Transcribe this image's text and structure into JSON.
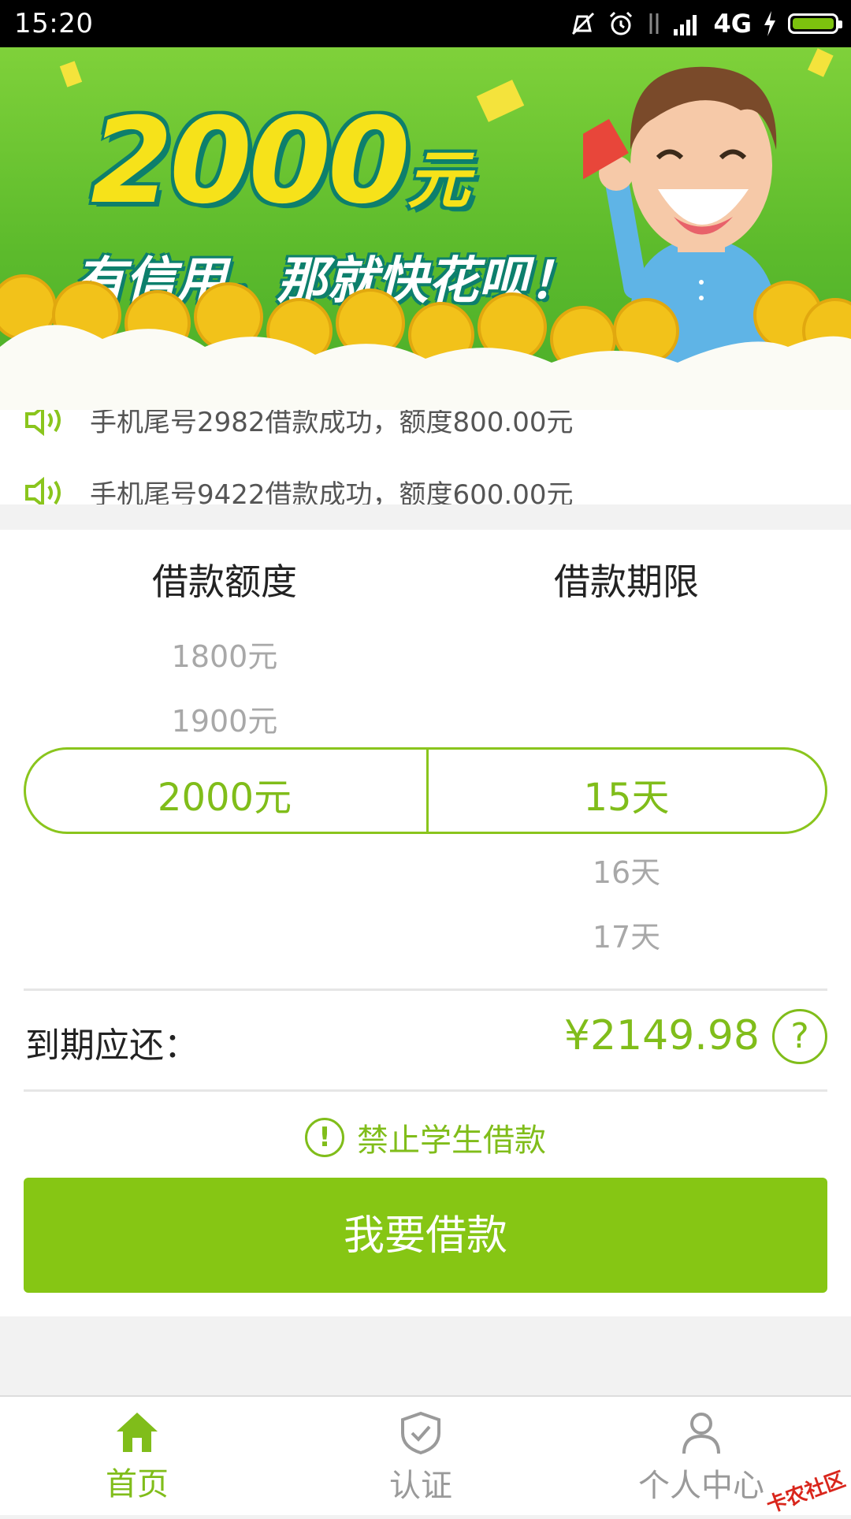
{
  "status_bar": {
    "time": "15:20",
    "network": "4G",
    "icons": [
      "mute-icon",
      "alarm-icon",
      "data-arrows-icon",
      "signal-icon",
      "charging-icon",
      "battery-icon"
    ]
  },
  "banner": {
    "amount": "2000",
    "amount_unit": "元",
    "slogan": "有信用，那就快花呗！"
  },
  "ticker": {
    "items": [
      "手机尾号2982借款成功，额度800.00元",
      "手机尾号9422借款成功，额度600.00元"
    ]
  },
  "picker": {
    "amount_header": "借款额度",
    "term_header": "借款期限",
    "amount_options_above": [
      "1800元",
      "1900元"
    ],
    "amount_selected": "2000元",
    "term_selected": "15天",
    "term_options_below": [
      "16天",
      "17天"
    ]
  },
  "due": {
    "label": "到期应还：",
    "value": "¥2149.98",
    "help_symbol": "?"
  },
  "notice": {
    "symbol": "!",
    "text": "禁止学生借款"
  },
  "borrow_button": {
    "label": "我要借款"
  },
  "bottom_nav": {
    "items": [
      {
        "label": "首页",
        "icon": "home-icon",
        "active": true
      },
      {
        "label": "认证",
        "icon": "shield-check-icon",
        "active": false
      },
      {
        "label": "个人中心",
        "icon": "person-icon",
        "active": false
      }
    ]
  },
  "watermark": "卡农社区",
  "colors": {
    "accent": "#80bd1a",
    "button": "#86c614",
    "inactive": "#a8a8a8"
  }
}
